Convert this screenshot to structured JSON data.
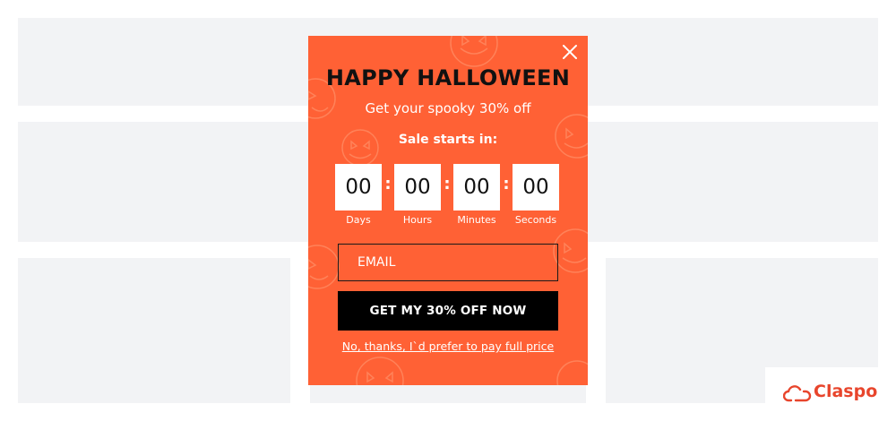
{
  "popup": {
    "title": "HAPPY HALLOWEEN",
    "subtitle": "Get your spooky 30% off",
    "sale_label": "Sale starts in:",
    "countdown": [
      {
        "value": "00",
        "label": "Days"
      },
      {
        "value": "00",
        "label": "Hours"
      },
      {
        "value": "00",
        "label": "Minutes"
      },
      {
        "value": "00",
        "label": "Seconds"
      }
    ],
    "email_placeholder": "EMAIL",
    "cta_label": "GET MY 30% OFF NOW",
    "decline_label": "No, thanks, I`d prefer to pay full price"
  },
  "brand": {
    "name": "Claspo",
    "icon": "cloud-link-icon",
    "color": "#e8452c"
  },
  "colors": {
    "popup_background": "#ff6135",
    "cta_background": "#000000",
    "placeholder_background": "#f2f3f5"
  }
}
